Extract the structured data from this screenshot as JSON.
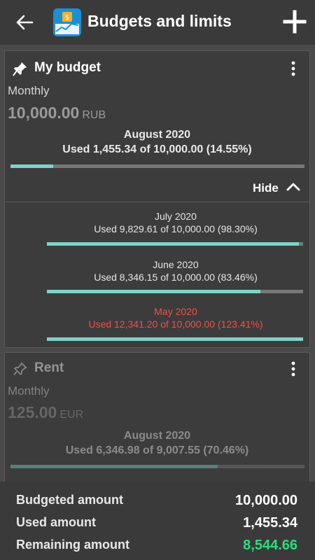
{
  "appbar": {
    "title": "Budgets and limits",
    "back_icon": "arrow-left-icon",
    "add_icon": "plus-icon",
    "logo_icon": "budget-app-logo-icon"
  },
  "budgets": [
    {
      "name": "My budget",
      "pinned": true,
      "period": "Monthly",
      "amount": "10,000.00",
      "currency": "RUB",
      "current_month": "August 2020",
      "current_used": "Used 1,455.34 of 10,000.00 (14.55%)",
      "current_fraction": 0.1455,
      "hide_label": "Hide",
      "history": [
        {
          "month": "July 2020",
          "used": "Used 9,829.61 of 10,000.00 (98.30%)",
          "fraction": 0.983,
          "over": false
        },
        {
          "month": "June 2020",
          "used": "Used 8,346.15 of 10,000.00 (83.46%)",
          "fraction": 0.8346,
          "over": false
        },
        {
          "month": "May 2020",
          "used": "Used 12,341.20 of 10,000.00 (123.41%)",
          "fraction": 1.0,
          "over": true
        }
      ]
    },
    {
      "name": "Rent",
      "pinned": false,
      "period": "Monthly",
      "amount": "125.00",
      "currency": "EUR",
      "current_month": "August 2020",
      "current_used": "Used 6,346.98 of 9,007.55 (70.46%)",
      "current_fraction": 0.7046
    }
  ],
  "summary": {
    "budgeted_label": "Budgeted amount",
    "budgeted_value": "10,000.00",
    "used_label": "Used amount",
    "used_value": "1,455.34",
    "remaining_label": "Remaining amount",
    "remaining_value": "8,544.66"
  },
  "colors": {
    "bar_fill": "#7fd3c7",
    "over_budget": "#ef4f4b",
    "remaining": "#28e07a"
  }
}
